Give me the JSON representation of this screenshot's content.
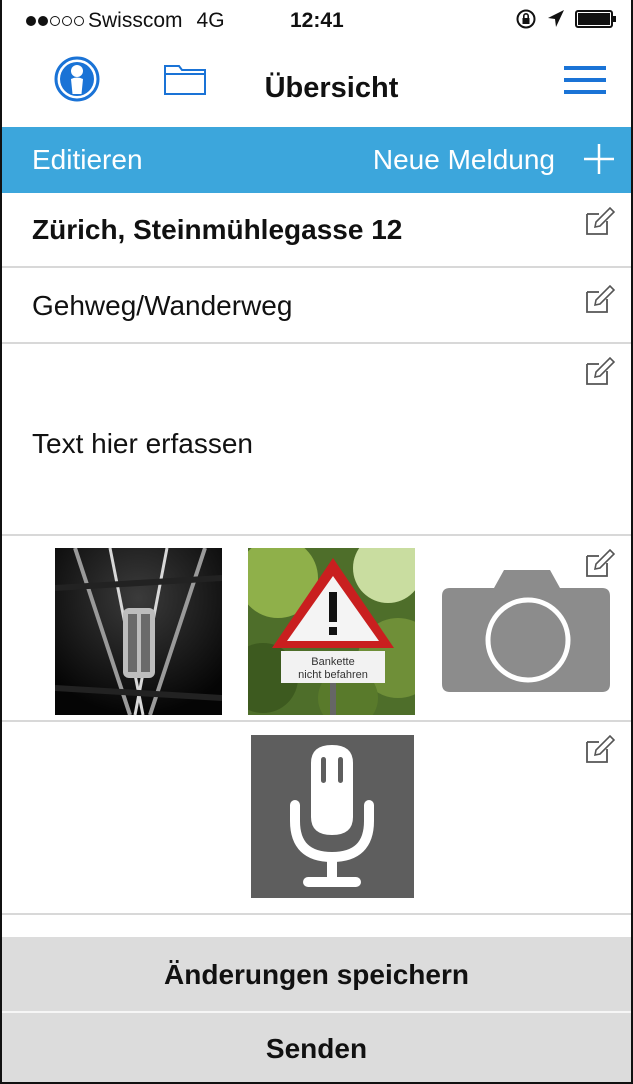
{
  "status_bar": {
    "signal_filled": 2,
    "signal_total": 5,
    "carrier": "Swisscom",
    "network": "4G",
    "time": "12:41"
  },
  "nav": {
    "title": "Übersicht",
    "icons": {
      "profile": "person-circle-icon",
      "folder": "folder-icon",
      "menu": "hamburger-menu-icon"
    },
    "accent_color": "#1a73d6"
  },
  "toolbar": {
    "edit_label": "Editieren",
    "new_label": "Neue Meldung",
    "background": "#3ca6dc"
  },
  "report": {
    "address": "Zürich, Steinmühlegasse 12",
    "category": "Gehweg/Wanderweg",
    "text_placeholder": "Text hier erfassen",
    "photos": [
      {
        "subject": "railway-switch-photo"
      },
      {
        "subject": "warning-sign-photo",
        "sign_text_1": "Bankette",
        "sign_text_2": "nicht befahren"
      }
    ]
  },
  "actions": {
    "save_label": "Änderungen speichern",
    "send_label": "Senden"
  }
}
